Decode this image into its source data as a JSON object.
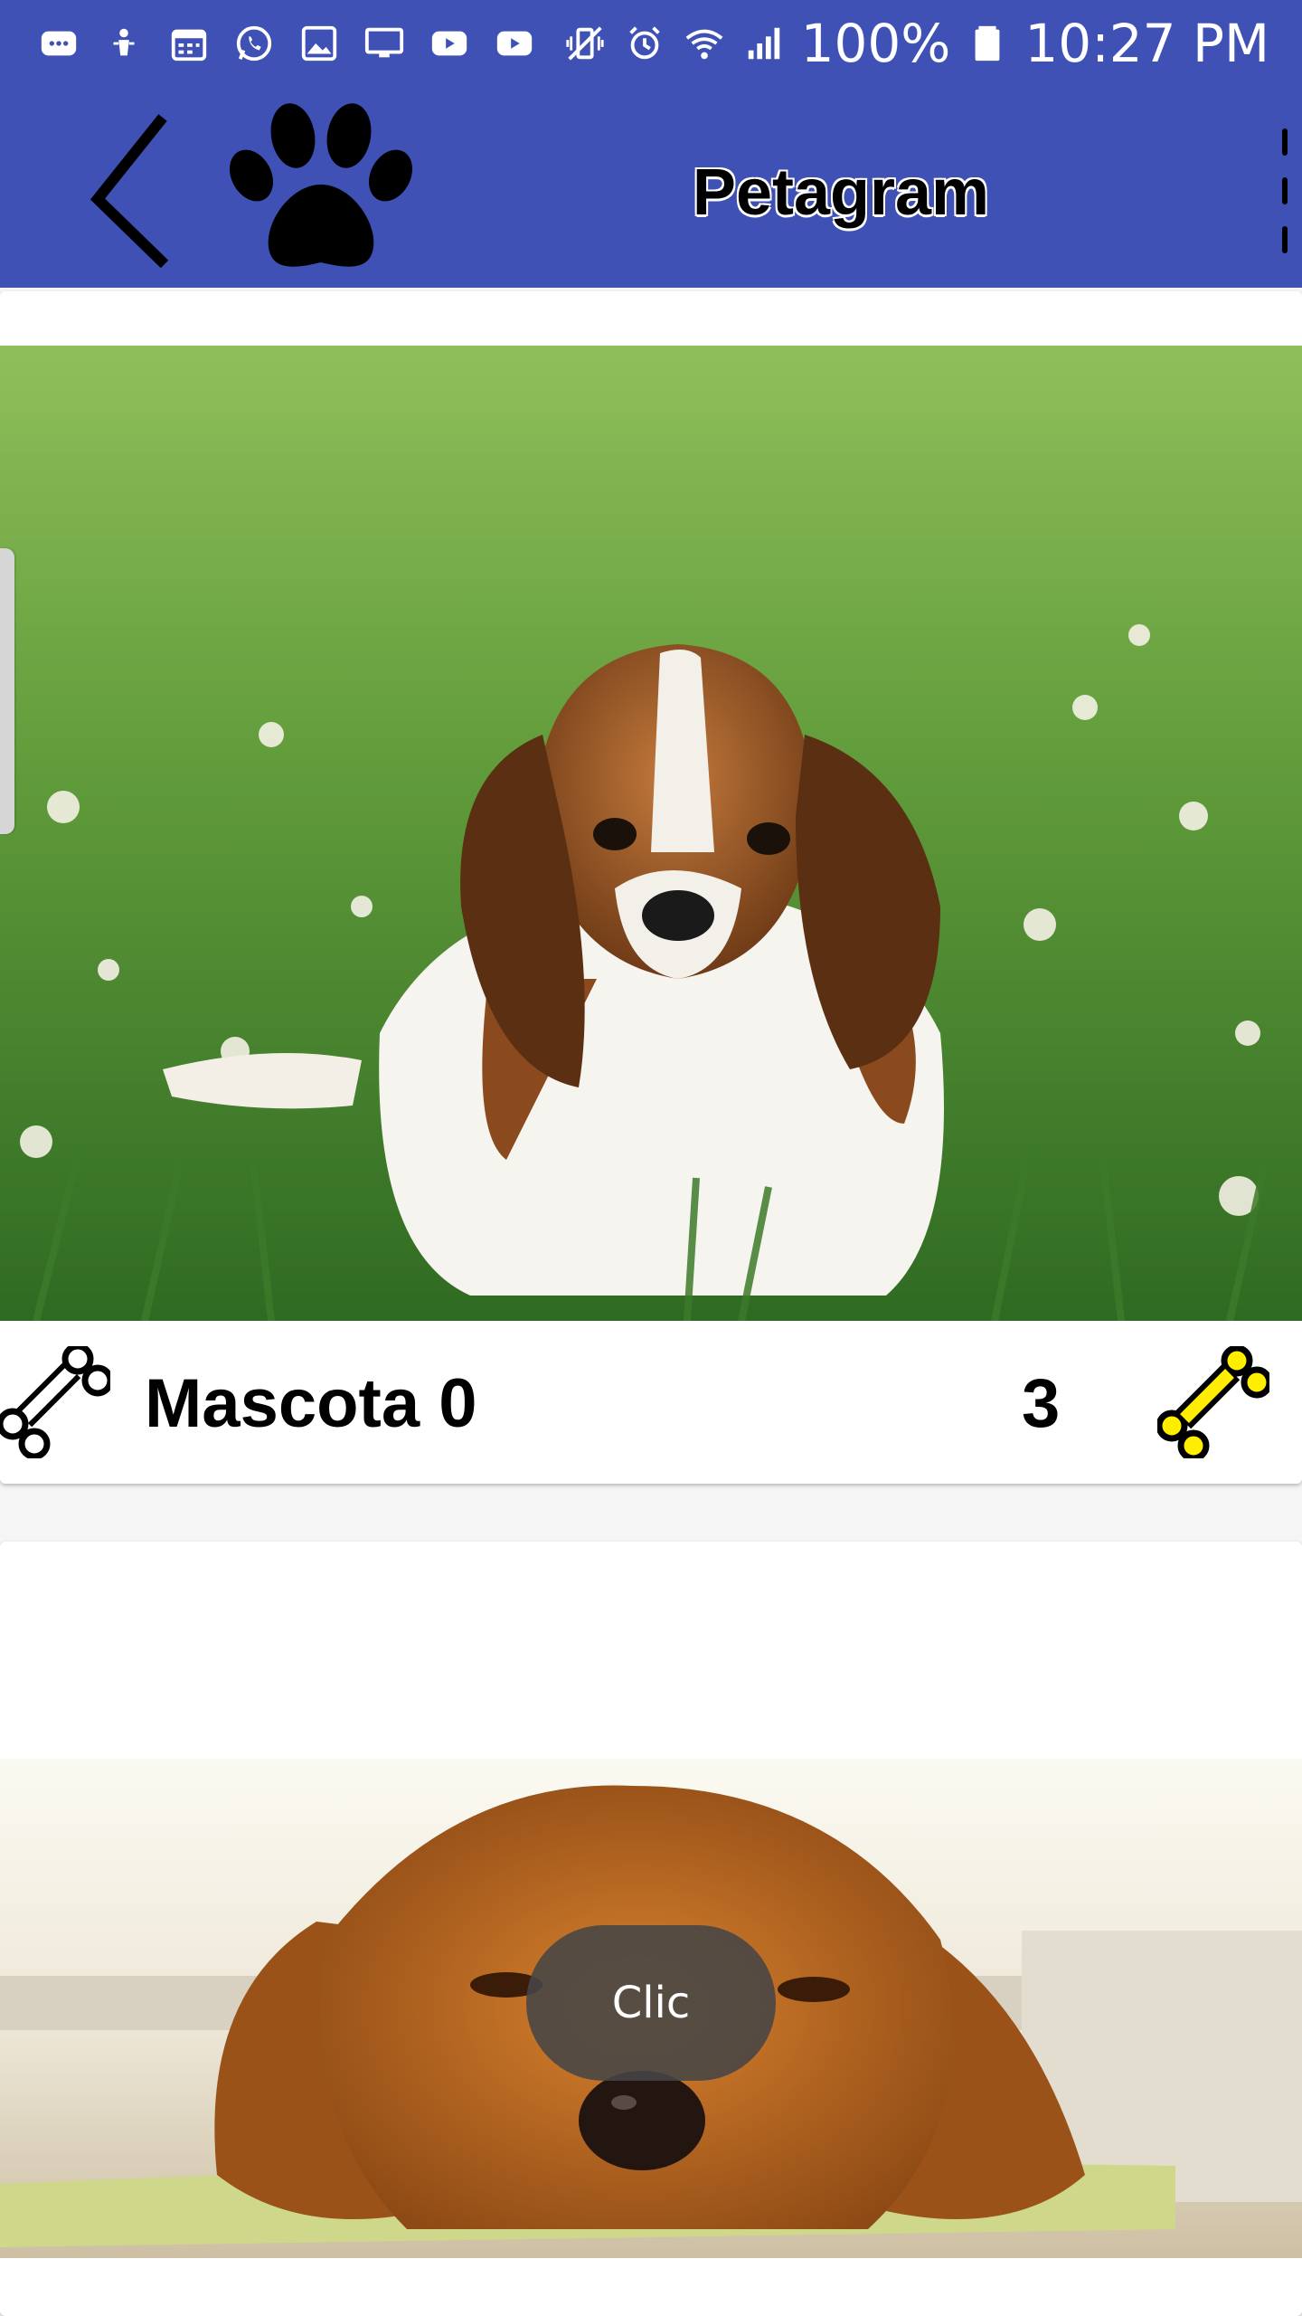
{
  "status_bar": {
    "battery": "100%",
    "time": "10:27 PM",
    "icons": [
      "message-icon",
      "bug-icon",
      "calendar-icon",
      "whatsapp-icon",
      "gallery-icon",
      "screen-cast-icon",
      "youtube-icon",
      "youtube-icon",
      "vibrate-icon",
      "alarm-icon",
      "wifi-icon",
      "signal-icon",
      "battery-icon"
    ]
  },
  "app_bar": {
    "title": "Petagram",
    "back_icon": "back-arrow-icon",
    "logo_icon": "paw-icon",
    "menu_icon": "overflow-menu-icon",
    "color": "#3f51b5"
  },
  "pets": [
    {
      "name": "Mascota 0",
      "rating": "3",
      "photo": "beagle-puppy-photo"
    },
    {
      "name": "",
      "rating": "",
      "photo": "golden-retriever-puppy-photo"
    }
  ],
  "toast": {
    "text": "Clic"
  },
  "colors": {
    "bone_highlight": "#ffee00",
    "primary": "#3f51b5"
  }
}
